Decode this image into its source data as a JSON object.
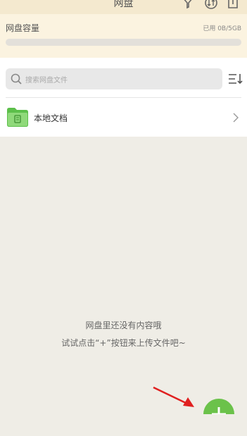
{
  "header": {
    "title": "网盘",
    "icons": [
      "filter-icon",
      "transfer-icon",
      "upload-box-icon"
    ]
  },
  "capacity": {
    "title": "网盘容量",
    "used_label": "已用 0B/5GB",
    "used_fraction": 0
  },
  "search": {
    "placeholder": "搜索网盘文件"
  },
  "local_docs": {
    "label": "本地文档"
  },
  "empty_state": {
    "line1": "网盘里还没有内容哦",
    "line2": "试试点击“+”按钮来上传文件吧~"
  },
  "colors": {
    "accent": "#6bc24a",
    "header_bg": "#f4e9cf",
    "arrow": "#e02020"
  }
}
